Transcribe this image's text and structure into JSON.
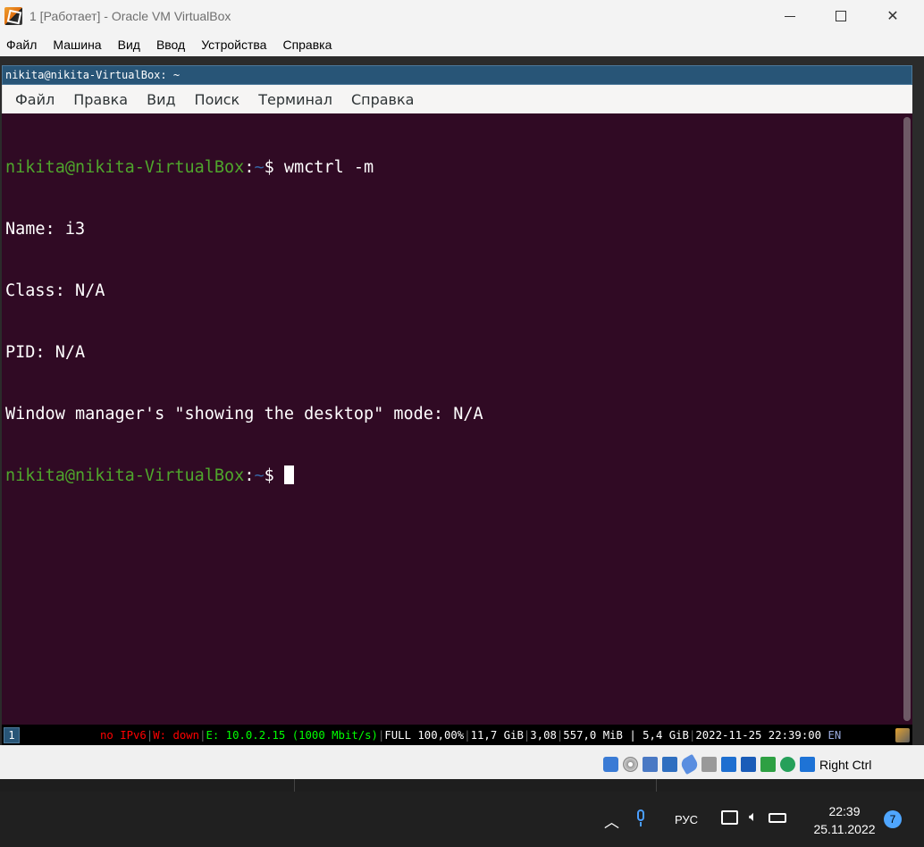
{
  "window": {
    "title": "1 [Работает] - Oracle VM VirtualBox"
  },
  "host_menu": [
    "Файл",
    "Машина",
    "Вид",
    "Ввод",
    "Устройства",
    "Справка"
  ],
  "terminal": {
    "title": "nikita@nikita-VirtualBox: ~",
    "menu": [
      "Файл",
      "Правка",
      "Вид",
      "Поиск",
      "Терминал",
      "Справка"
    ],
    "prompt_user": "nikita@nikita-VirtualBox",
    "prompt_sep": ":",
    "prompt_path": "~",
    "prompt_dollar": "$ ",
    "command": "wmctrl -m",
    "output": [
      "Name: i3",
      "Class: N/A",
      "PID: N/A",
      "Window manager's \"showing the desktop\" mode: N/A"
    ]
  },
  "i3bar": {
    "workspace": "1",
    "ipv6": "no IPv6",
    "wifi": "W: down",
    "eth": "E: 10.0.2.15 (1000 Mbit/s)",
    "battery": "FULL 100,00%",
    "disk": "11,7 GiB",
    "load": "3,08",
    "mem": "557,0 MiB | 5,4 GiB",
    "datetime": "2022-11-25 22:39:00",
    "layout": "EN",
    "separator": "|"
  },
  "vbox_status": {
    "host_key": "Right Ctrl"
  },
  "taskbar": {
    "language": "РУС",
    "time": "22:39",
    "date": "25.11.2022",
    "notification_count": "7"
  },
  "colors": {
    "terminal_bg": "#300a24",
    "prompt_user": "#4fa62c",
    "prompt_path": "#3465a4",
    "i3_focus": "#285577"
  }
}
